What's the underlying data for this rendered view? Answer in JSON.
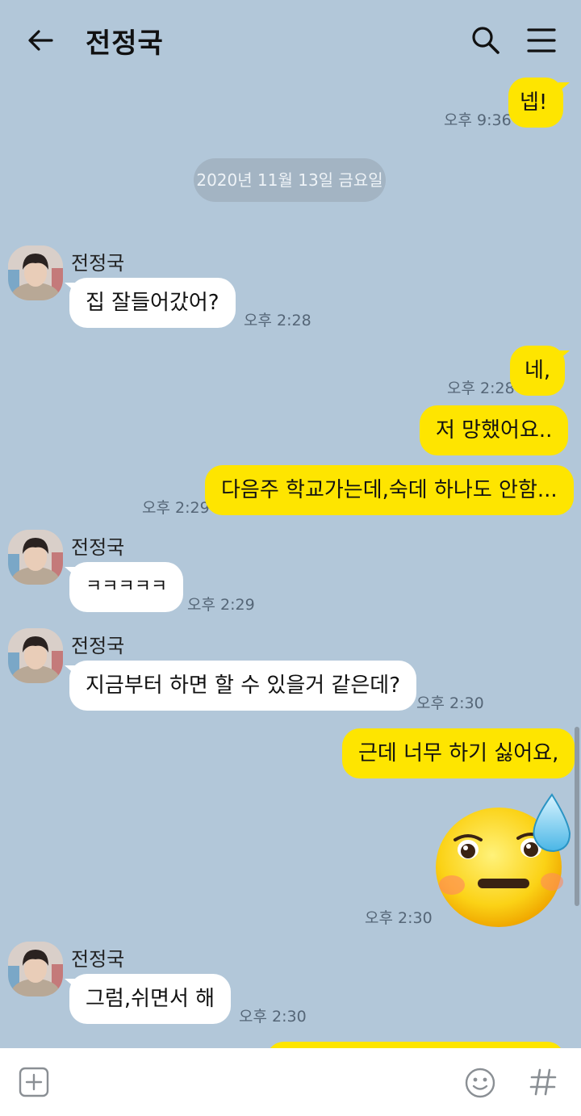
{
  "header": {
    "title": "전정국",
    "back_icon": "back-arrow-icon",
    "search_icon": "search-icon",
    "menu_icon": "menu-icon"
  },
  "date_separator": "2020년 11월 13일 금요일",
  "contact_name": "전정국",
  "messages": [
    {
      "sender": "me",
      "text": "넵!",
      "time": "오후 9:36"
    },
    {
      "sender": "them",
      "text": "집 잘들어갔어?",
      "time": "오후 2:28"
    },
    {
      "sender": "me",
      "text": "네,",
      "time": "오후 2:28"
    },
    {
      "sender": "me",
      "text": "저 망했어요.."
    },
    {
      "sender": "me",
      "text": "다음주 학교가는데,숙데 하나도 안함...",
      "time": "오후 2:29"
    },
    {
      "sender": "them",
      "text": "ㅋㅋㅋㅋㅋ",
      "time": "오후 2:29"
    },
    {
      "sender": "them",
      "text": "지금부터 하면 할 수 있을거 같은데?",
      "time": "오후 2:30"
    },
    {
      "sender": "me",
      "text": "근데 너무 하기 싫어요,"
    },
    {
      "sender": "me",
      "emoticon": "sweating-sad-face-emoticon",
      "time": "오후 2:30"
    },
    {
      "sender": "them",
      "text": "그럼,쉬면서 해",
      "time": "오후 2:30"
    }
  ],
  "footer": {
    "attach_icon": "plus-box-icon",
    "emoji_icon": "smiley-icon",
    "hashtag_icon": "hashtag-icon"
  },
  "colors": {
    "background": "#b2c7d9",
    "my_bubble": "#fee500",
    "their_bubble": "#ffffff"
  }
}
